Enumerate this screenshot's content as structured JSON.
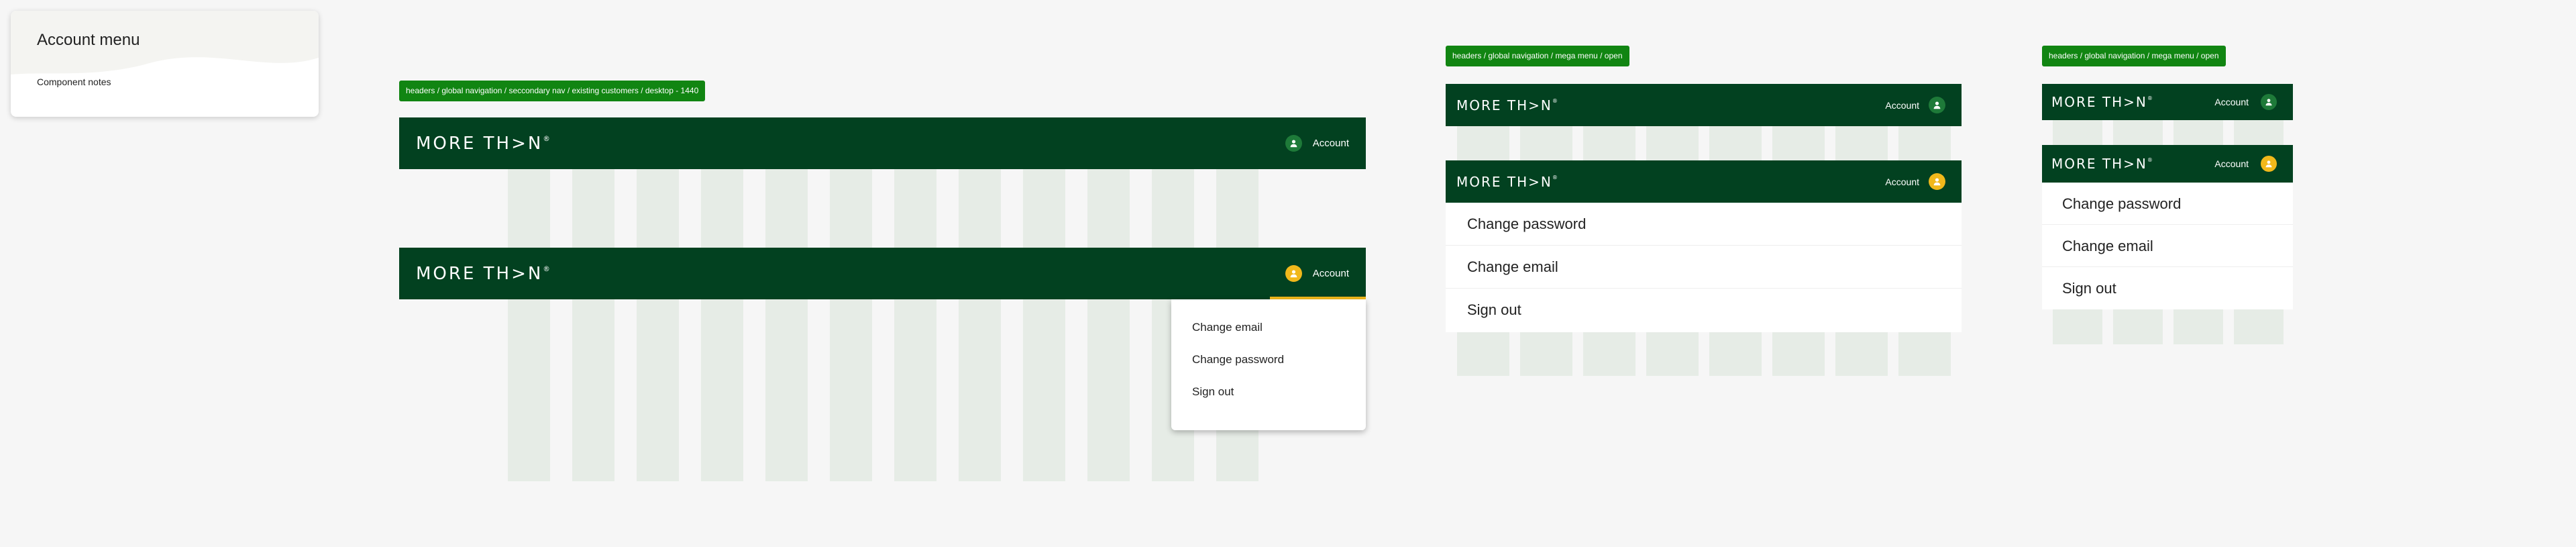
{
  "notes": {
    "title": "Account menu",
    "subtitle": "Component notes"
  },
  "tags": {
    "desktop": "headers / global navigation / seccondary nav / existing customers / desktop - 1440",
    "mega_menu_medium": "headers / global navigation / mega menu / open",
    "mega_menu_small": "headers / global navigation / mega menu / open"
  },
  "brand": {
    "logo": "MORE TH>N",
    "trademark": "®"
  },
  "account_label": "Account",
  "desktop_menu": [
    "Change email",
    "Change password",
    "Sign out"
  ],
  "medium_menu": [
    "Change password",
    "Change email",
    "Sign out"
  ],
  "small_menu": [
    "Change password",
    "Change email",
    "Sign out"
  ],
  "colors": {
    "header_bg": "#024120",
    "tag_bg": "#118512",
    "icon_inactive": "#1e7a39",
    "icon_active": "#f1b81b",
    "active_underline": "#f1b81b",
    "grid_column": "#e4ebe4"
  }
}
